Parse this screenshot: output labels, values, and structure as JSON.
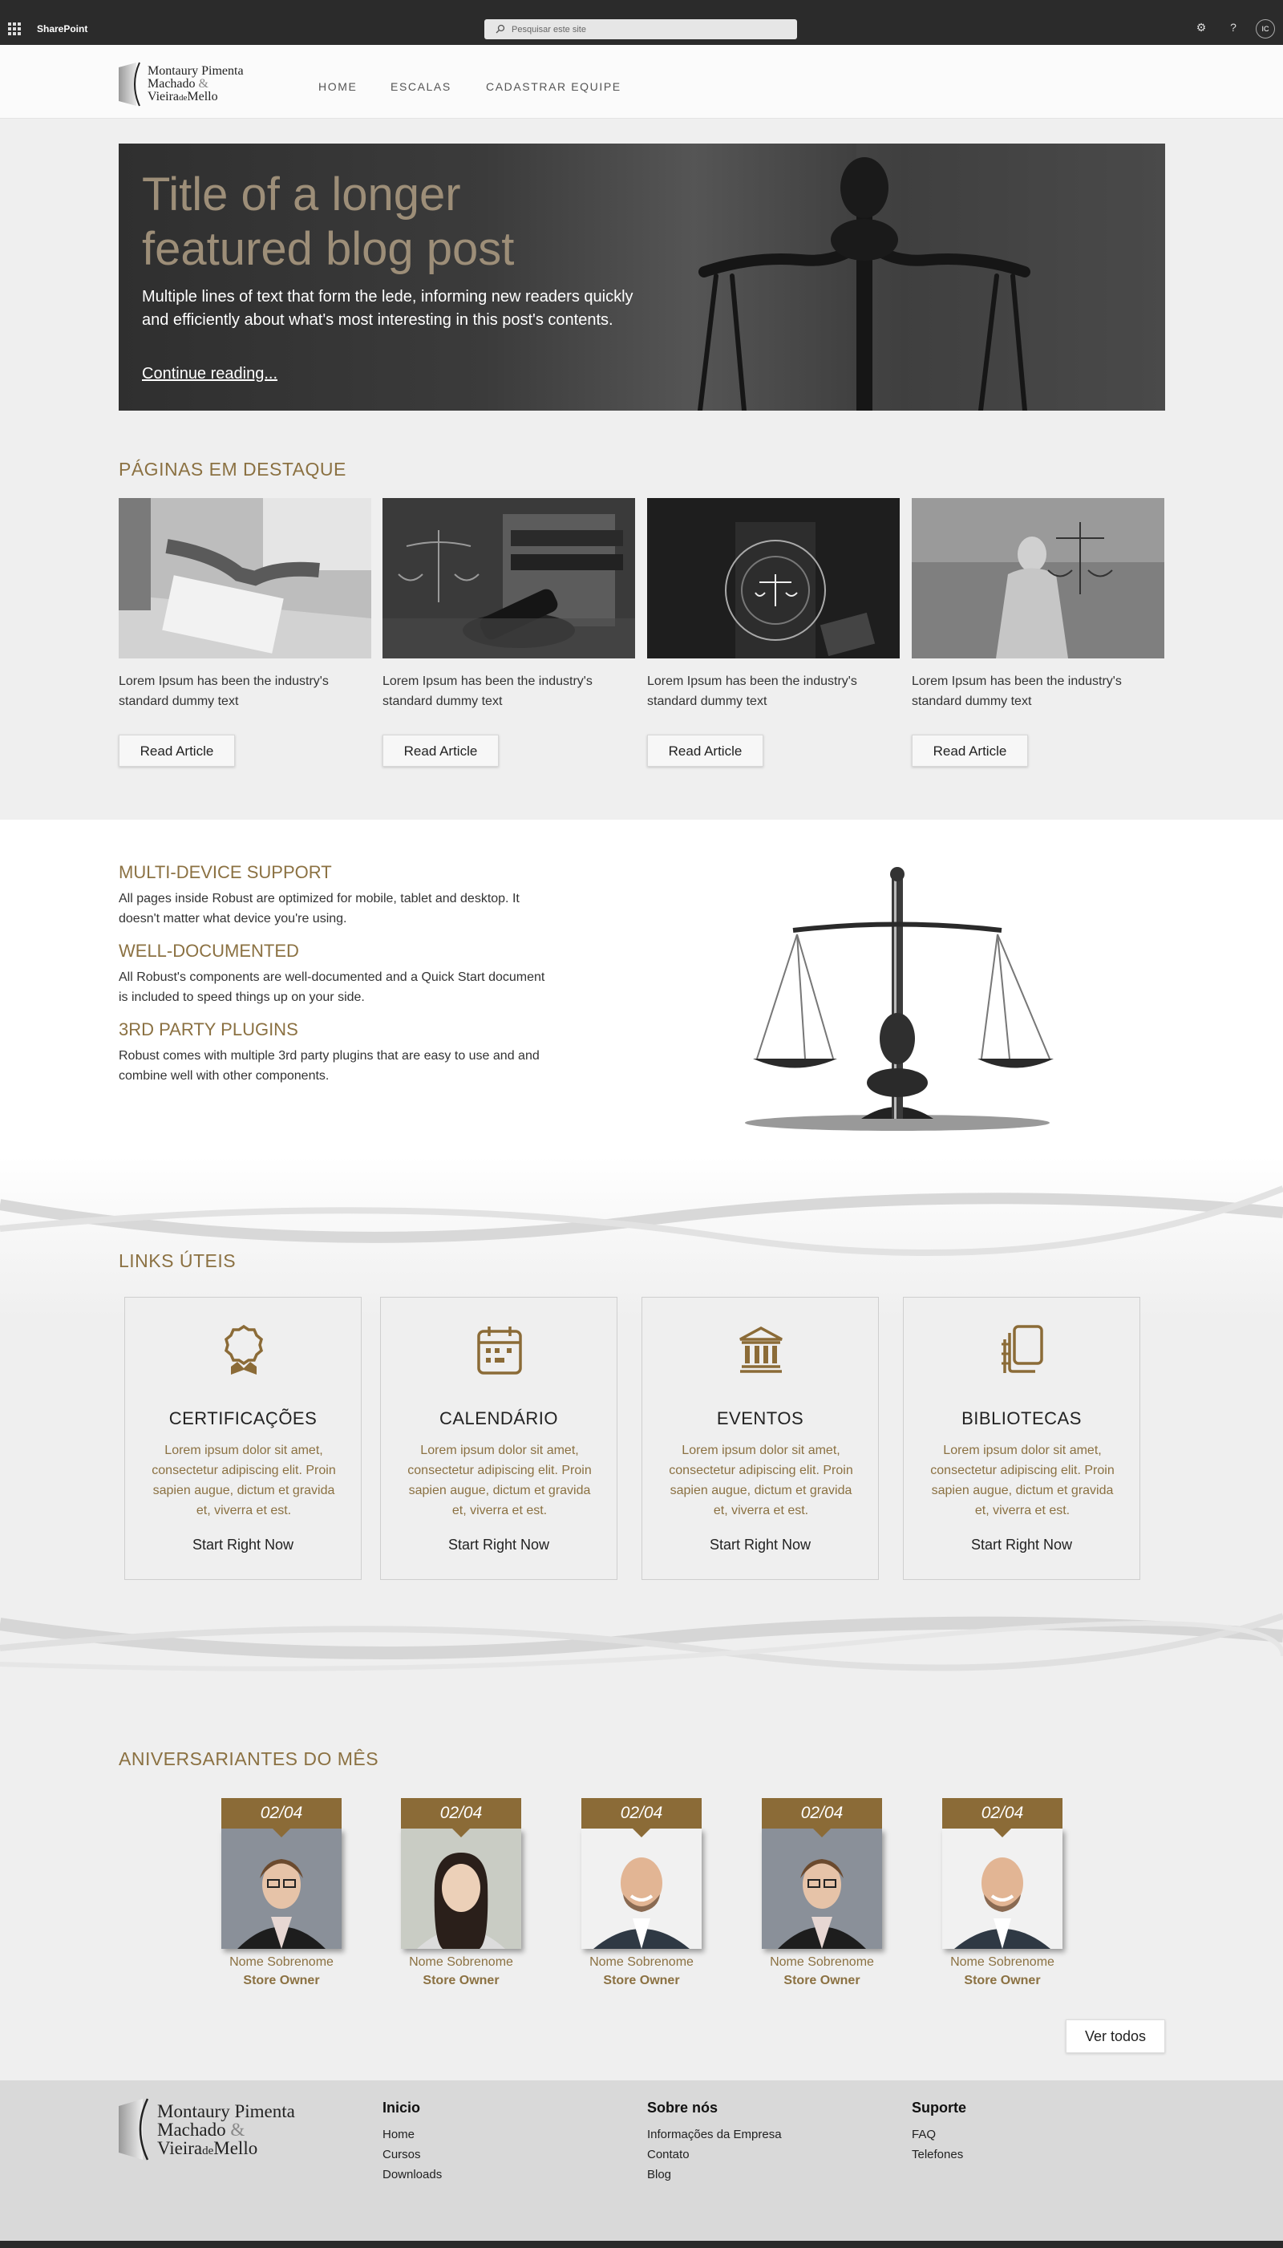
{
  "suite": {
    "brand": "SharePoint",
    "search_placeholder": "Pesquisar este site",
    "settings_glyph": "⚙",
    "help_glyph": "?",
    "avatar_initials": "IC"
  },
  "site": {
    "logo_line1": "Montaury Pimenta",
    "logo_line2": "Machado",
    "logo_amp": "&",
    "logo_line3a": "Vieira",
    "logo_line3b": "de",
    "logo_line3c": "Mello",
    "nav": [
      "HOME",
      "ESCALAS",
      "CADASTRAR EQUIPE"
    ]
  },
  "hero": {
    "title": "Title of a longer featured blog post",
    "lede": "Multiple lines of text that form the lede, informing new readers quickly and efficiently about what's most interesting in this post's contents.",
    "link": "Continue reading..."
  },
  "featured_pages": {
    "title": "PÁGINAS EM DESTAQUE",
    "cards": [
      {
        "text": "Lorem Ipsum has been the industry's standard dummy text",
        "button": "Read Article",
        "image": "handshake-photo"
      },
      {
        "text": "Lorem Ipsum has been the industry's standard dummy text",
        "button": "Read Article",
        "image": "gavel-scales-books-photo"
      },
      {
        "text": "Lorem Ipsum has been the industry's standard dummy text",
        "button": "Read Article",
        "image": "digital-law-icons-photo"
      },
      {
        "text": "Lorem Ipsum has been the industry's standard dummy text",
        "button": "Read Article",
        "image": "lady-justice-statue-photo"
      }
    ]
  },
  "features": [
    {
      "title": "MULTI-DEVICE SUPPORT",
      "text": "All pages inside Robust are optimized for mobile, tablet and desktop. It doesn't matter what device you're using."
    },
    {
      "title": "WELL-DOCUMENTED",
      "text": "All Robust's components are well-documented and a Quick Start document is included to speed things up on your side."
    },
    {
      "title": "3RD PARTY PLUGINS",
      "text": "Robust comes with multiple 3rd party plugins that are easy to use and and combine well with other components."
    }
  ],
  "useful_links": {
    "title": "LINKS ÚTEIS",
    "items": [
      {
        "title": "CERTIFICAÇÕES",
        "icon": "award-icon",
        "desc": "Lorem ipsum dolor sit amet, consectetur adipiscing elit. Proin sapien augue, dictum et gravida et, viverra et est.",
        "link": "Start Right Now"
      },
      {
        "title": "CALENDÁRIO",
        "icon": "calendar-icon",
        "desc": "Lorem ipsum dolor sit amet, consectetur adipiscing elit. Proin sapien augue, dictum et gravida et, viverra et est.",
        "link": "Start Right Now"
      },
      {
        "title": "EVENTOS",
        "icon": "building-icon",
        "desc": "Lorem ipsum dolor sit amet, consectetur adipiscing elit. Proin sapien augue, dictum et gravida et, viverra et est.",
        "link": "Start Right Now"
      },
      {
        "title": "BIBLIOTECAS",
        "icon": "notebook-icon",
        "desc": "Lorem ipsum dolor sit amet, consectetur adipiscing elit. Proin sapien augue, dictum et gravida et, viverra et est.",
        "link": "Start Right Now"
      }
    ]
  },
  "birthdays": {
    "title": "ANIVERSARIANTES DO MÊS",
    "people": [
      {
        "date": "02/04",
        "name": "Nome Sobrenome",
        "role": "Store Owner",
        "photo": "woman-glasses"
      },
      {
        "date": "02/04",
        "name": "Nome Sobrenome",
        "role": "Store Owner",
        "photo": "woman-asian"
      },
      {
        "date": "02/04",
        "name": "Nome Sobrenome",
        "role": "Store Owner",
        "photo": "man-bald"
      },
      {
        "date": "02/04",
        "name": "Nome Sobrenome",
        "role": "Store Owner",
        "photo": "woman-glasses"
      },
      {
        "date": "02/04",
        "name": "Nome Sobrenome",
        "role": "Store Owner",
        "photo": "man-bald"
      }
    ],
    "see_all": "Ver todos"
  },
  "footer": {
    "columns": [
      {
        "heading": "Inicio",
        "items": [
          "Home",
          "Cursos",
          "Downloads"
        ]
      },
      {
        "heading": "Sobre nós",
        "items": [
          "Informações da Empresa",
          "Contato",
          "Blog"
        ]
      },
      {
        "heading": "Suporte",
        "items": [
          "FAQ",
          "Telefones"
        ]
      }
    ]
  },
  "colors": {
    "accent": "#8b7142",
    "date_tag": "#8b6b37",
    "suitebar": "#2b2b2b",
    "hero_title": "#9d8e78"
  }
}
